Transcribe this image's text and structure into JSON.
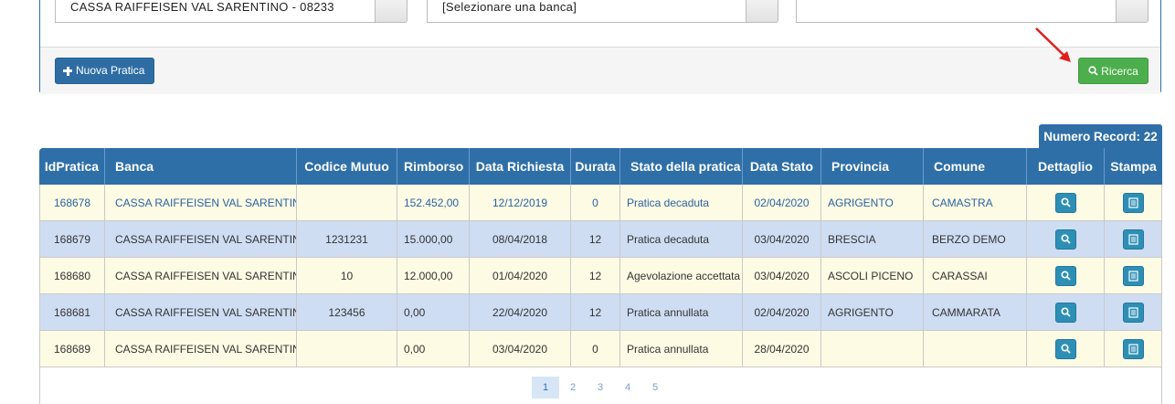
{
  "filters": {
    "istituto_value": "CASSA RAIFFEISEN VAL SARENTINO - 08233",
    "banca_value": "[Selezionare una banca]",
    "third_value": ""
  },
  "actions": {
    "new_label": "Nuova Pratica",
    "search_label": "Ricerca"
  },
  "record_count": "Numero Record: 22",
  "table": {
    "headers": [
      "IdPratica",
      "Banca",
      "Codice Mutuo",
      "Rimborso",
      "Data Richiesta",
      "Durata",
      "Stato della pratica",
      "Data Stato",
      "Provincia",
      "Comune",
      "Dettaglio",
      "Stampa"
    ],
    "rows": [
      {
        "id": "168678",
        "banca": "CASSA RAIFFEISEN VAL SARENTINO",
        "codice": "",
        "rimborso": "152.452,00",
        "data_richiesta": "12/12/2019",
        "durata": "0",
        "stato": "Pratica decaduta",
        "data_stato": "02/04/2020",
        "provincia": "AGRIGENTO",
        "comune": "CAMASTRA"
      },
      {
        "id": "168679",
        "banca": "CASSA RAIFFEISEN VAL SARENTINO",
        "codice": "1231231",
        "rimborso": "15.000,00",
        "data_richiesta": "08/04/2018",
        "durata": "12",
        "stato": "Pratica decaduta",
        "data_stato": "03/04/2020",
        "provincia": "BRESCIA",
        "comune": "BERZO DEMO"
      },
      {
        "id": "168680",
        "banca": "CASSA RAIFFEISEN VAL SARENTINO",
        "codice": "10",
        "rimborso": "12.000,00",
        "data_richiesta": "01/04/2020",
        "durata": "12",
        "stato": "Agevolazione accettata",
        "data_stato": "03/04/2020",
        "provincia": "ASCOLI PICENO",
        "comune": "CARASSAI"
      },
      {
        "id": "168681",
        "banca": "CASSA RAIFFEISEN VAL SARENTINO",
        "codice": "123456",
        "rimborso": "0,00",
        "data_richiesta": "22/04/2020",
        "durata": "12",
        "stato": "Pratica annullata",
        "data_stato": "02/04/2020",
        "provincia": "AGRIGENTO",
        "comune": "CAMMARATA"
      },
      {
        "id": "168689",
        "banca": "CASSA RAIFFEISEN VAL SARENTINO",
        "codice": "",
        "rimborso": "0,00",
        "data_richiesta": "03/04/2020",
        "durata": "0",
        "stato": "Pratica annullata",
        "data_stato": "28/04/2020",
        "provincia": "",
        "comune": ""
      }
    ]
  },
  "pagination": {
    "pages": [
      "1",
      "2",
      "3",
      "4",
      "5"
    ],
    "current": "1"
  },
  "colors": {
    "primary": "#2f6fa8",
    "success": "#4cae4c",
    "row_yellow": "#fdfbe3",
    "row_blue": "#cfddf3",
    "arrow": "#e0201b"
  }
}
